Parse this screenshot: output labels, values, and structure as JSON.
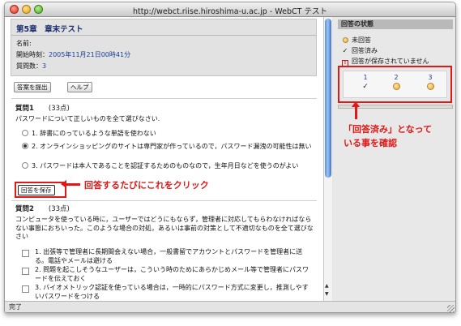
{
  "window": {
    "title": "http://webct.riise.hiroshima-u.ac.jp - WebCT テスト"
  },
  "header": {
    "chapter_title": "第5章　章末テスト",
    "name_label": "名前:",
    "name_value": "",
    "start_label": "開始時刻：",
    "start_value": "2005年11月21日00時41分",
    "count_label": "質問数：",
    "count_value": "3"
  },
  "toolbar": {
    "submit_label": "答案を提出",
    "help_label": "ヘルプ"
  },
  "questions": [
    {
      "label": "質問1",
      "points": "(33点)",
      "prompt": "パスワードについて正しいものを全て選びなさい.",
      "options": [
        {
          "text": "1. 辞書にのっているような単語を使わない",
          "selected": false
        },
        {
          "text": "2. オンラインショッピングのサイトは専門家が作っているので，パスワード漏洩の可能性は無い",
          "selected": true
        },
        {
          "text": "3. パスワードは本人であることを認証するためのものなので，生年月日などを使うのがよい",
          "selected": false
        }
      ],
      "save_label": "回答を保存"
    },
    {
      "label": "質問2",
      "points": "(33点)",
      "prompt": "コンピュータを使っている時に，ユーザーではどうにもならず，管理者に対応してもらわなければならない事態におちいった。このような場合の対処，あるいは事前の対策として不適切なものを全て選びなさい",
      "options": [
        {
          "text": "1. 出張等で管理者に長期間会えない場合，一般書留でアカウントとパスワードを管理者に送る。電話やメールは避ける"
        },
        {
          "text": "2. 問題を起こしそうなユーザーは，こういう時のためにあらかじめメール等で管理者にパスワードを伝えておく"
        },
        {
          "text": "3. バイオメトリック認証を使っている場合は，一時的にパスワード方式に変更し，推測しやすいパスワードをつける"
        }
      ]
    }
  ],
  "status_panel": {
    "title": "回答の状態",
    "legend": {
      "unanswered": "未回答",
      "answered": "回答済み",
      "not_saved": "回答が保存されていません"
    },
    "items": [
      {
        "number": "1",
        "state": "answered"
      },
      {
        "number": "2",
        "state": "unanswered"
      },
      {
        "number": "3",
        "state": "unanswered"
      }
    ]
  },
  "statusbar": {
    "text": "完了"
  },
  "annotations": {
    "save_note": "回答するたびにこれをクリック",
    "status_note_line1": "「回答済み」となって",
    "status_note_line2": "いる事を確認"
  },
  "colors": {
    "annotation": "#e01818",
    "link_blue": "#1b3d96",
    "chapter_navy": "#1b2e6e"
  }
}
